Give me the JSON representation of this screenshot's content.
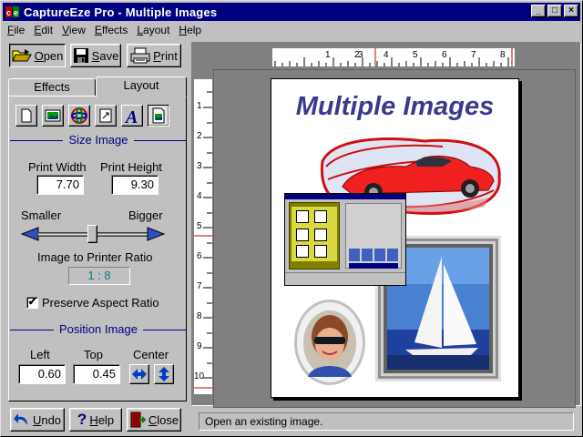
{
  "window": {
    "title": "CaptureEze Pro - Multiple Images",
    "minimize": "_",
    "maximize": "□",
    "close": "×"
  },
  "menu": [
    "File",
    "Edit",
    "View",
    "Effects",
    "Layout",
    "Help"
  ],
  "toolbar": {
    "open": "Open",
    "save": "Save",
    "print": "Print"
  },
  "tabs": {
    "effects": "Effects",
    "layout": "Layout"
  },
  "tools": [
    "blank-page-icon",
    "image-icon",
    "effects-icon",
    "crop-icon",
    "text-icon",
    "image-frame-icon"
  ],
  "size_image": {
    "heading": "Size Image",
    "print_width_label": "Print Width",
    "print_width_value": "7.70",
    "print_height_label": "Print Height",
    "print_height_value": "9.30",
    "smaller_label": "Smaller",
    "bigger_label": "Bigger",
    "ratio_label": "Image to Printer Ratio",
    "ratio_value": "1 : 8",
    "preserve_label": "Preserve Aspect Ratio",
    "preserve_checked": "✔"
  },
  "position_image": {
    "heading": "Position Image",
    "left_label": "Left",
    "left_value": "0.60",
    "top_label": "Top",
    "top_value": "0.45",
    "center_label": "Center"
  },
  "bottom_buttons": {
    "undo": "Undo",
    "help": "Help",
    "close": "Close"
  },
  "ruler": {
    "h_numbers": [
      "1",
      "2",
      "3",
      "4",
      "5",
      "6",
      "7",
      "8"
    ],
    "v_numbers": [
      "1",
      "2",
      "3",
      "4",
      "5",
      "6",
      "7",
      "8",
      "9",
      "10"
    ]
  },
  "page": {
    "headline": "Multiple Images"
  },
  "status": "Open an existing image.",
  "colors": {
    "title_bar": "#000080",
    "headline": "#3c3a8c",
    "accent": "#000080",
    "ratio_text": "#008080"
  }
}
